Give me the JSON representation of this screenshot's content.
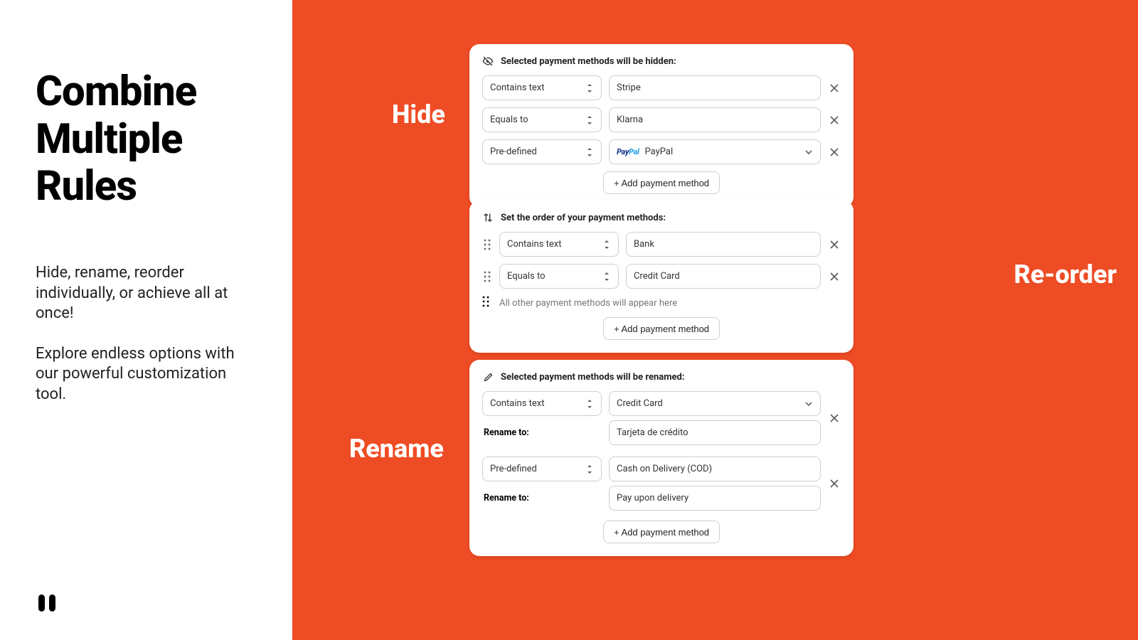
{
  "left": {
    "heading": "Combine Multiple Rules",
    "p1": "Hide, rename, reorder individually, or achieve all at once!",
    "p2": "Explore endless options with our powerful customization tool."
  },
  "labels": {
    "hide": "Hide",
    "reorder": "Re-order",
    "rename": "Rename"
  },
  "hide": {
    "title": "Selected payment methods will be hidden:",
    "rows": [
      {
        "match": "Contains text",
        "value": "Stripe"
      },
      {
        "match": "Equals to",
        "value": "Klarna"
      },
      {
        "match": "Pre-defined",
        "value": "PayPal",
        "brand": "paypal"
      }
    ],
    "add": "+ Add payment method"
  },
  "reorder": {
    "title": "Set the order of your payment methods:",
    "rows": [
      {
        "match": "Contains text",
        "value": "Bank"
      },
      {
        "match": "Equals to",
        "value": "Credit Card"
      }
    ],
    "note": "All other payment methods will appear here",
    "add": "+ Add payment method"
  },
  "rename": {
    "title": "Selected payment methods will be renamed:",
    "rename_to_label": "Rename to:",
    "pairs": [
      {
        "match": "Contains text",
        "value": "Credit Card",
        "value_type": "dropdown",
        "rename_to": "Tarjeta de crédito"
      },
      {
        "match": "Pre-defined",
        "value": "Cash on Delivery (COD)",
        "value_type": "text",
        "rename_to": "Pay upon delivery"
      }
    ],
    "add": "+ Add payment method"
  }
}
